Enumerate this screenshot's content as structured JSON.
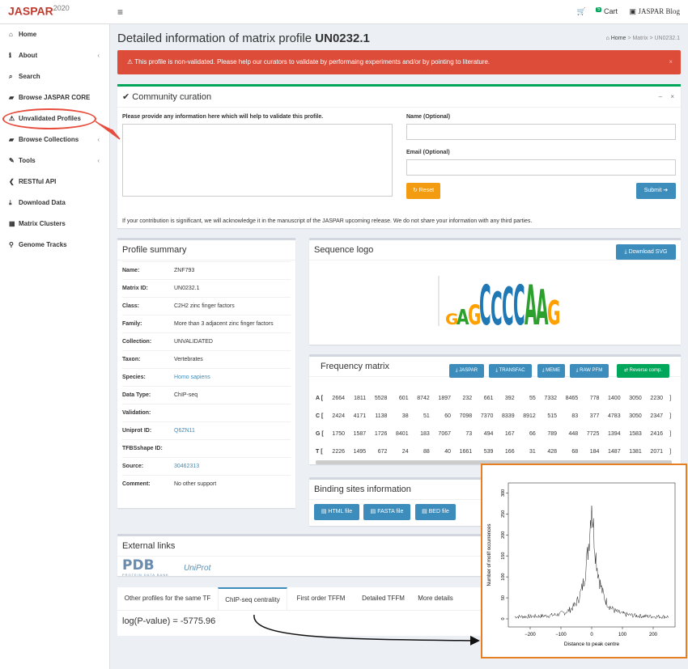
{
  "topbar": {
    "logo_text": "JASPAR",
    "logo_year": "2020",
    "cart_label": "Cart",
    "cart_count": "5",
    "blog_label": "JASPAR Blog"
  },
  "sidebar": {
    "items": [
      {
        "label": "Home",
        "icon": "home-icon",
        "glyph": "⌂",
        "chevron": ""
      },
      {
        "label": "About",
        "icon": "info-icon",
        "glyph": "ℹ",
        "chevron": "‹"
      },
      {
        "label": "Search",
        "icon": "search-icon",
        "glyph": "⌕",
        "chevron": ""
      },
      {
        "label": "Browse JASPAR CORE",
        "icon": "folder-icon",
        "glyph": "▰",
        "chevron": ""
      },
      {
        "label": "Unvalidated Profiles",
        "icon": "warning-icon",
        "glyph": "⚠",
        "chevron": ""
      },
      {
        "label": "Browse Collections",
        "icon": "folder-icon",
        "glyph": "▰",
        "chevron": "‹"
      },
      {
        "label": "Tools",
        "icon": "wrench-icon",
        "glyph": "✎",
        "chevron": "‹"
      },
      {
        "label": "RESTful API",
        "icon": "code-icon",
        "glyph": "❮",
        "chevron": ""
      },
      {
        "label": "Download Data",
        "icon": "download-icon",
        "glyph": "⤓",
        "chevron": ""
      },
      {
        "label": "Matrix Clusters",
        "icon": "clusters-icon",
        "glyph": "▦",
        "chevron": ""
      },
      {
        "label": "Genome Tracks",
        "icon": "map-marker-icon",
        "glyph": "⚲",
        "chevron": ""
      }
    ]
  },
  "page": {
    "title_prefix": "Detailed information of matrix profile ",
    "title_id": "UN0232.1",
    "breadcrumb_home": "Home",
    "breadcrumb_rest": "Matrix > UN0232.1"
  },
  "alert": {
    "text": "This profile is non-validated. Please help our curators to validate by performaing experiments and/or by pointing to literature.",
    "close": "×"
  },
  "curation": {
    "title": "Community curation",
    "prompt": "Please provide any information here which will help to validate this profile.",
    "name_label": "Name (Optional)",
    "email_label": "Email (Optional)",
    "reset_label": "Reset",
    "submit_label": "Submit",
    "note": "If your contribution is significant, we will acknowledge it in the manuscript of the JASPAR upcoming release. We do not share your information with any third parties.",
    "tool_minus": "–",
    "tool_close": "×"
  },
  "summary": {
    "title": "Profile summary",
    "rows": [
      {
        "key": "Name:",
        "value": "ZNF793",
        "link": false
      },
      {
        "key": "Matrix ID:",
        "value": "UN0232.1",
        "link": false
      },
      {
        "key": "Class:",
        "value": "C2H2 zinc finger factors",
        "link": false
      },
      {
        "key": "Family:",
        "value": "More than 3 adjacent zinc finger factors",
        "link": false
      },
      {
        "key": "Collection:",
        "value": "UNVALIDATED",
        "link": false
      },
      {
        "key": "Taxon:",
        "value": "Vertebrates",
        "link": false
      },
      {
        "key": "Species:",
        "value": "Homo sapiens",
        "link": true
      },
      {
        "key": "Data Type:",
        "value": "ChIP-seq",
        "link": false
      },
      {
        "key": "Validation:",
        "value": "",
        "link": false
      },
      {
        "key": "Uniprot ID:",
        "value": "Q6ZN11",
        "link": true
      },
      {
        "key": "TFBSshape ID:",
        "value": "",
        "link": false
      },
      {
        "key": "Source:",
        "value": "30462313",
        "link": true
      },
      {
        "key": "Comment:",
        "value": "No other support",
        "link": false
      }
    ]
  },
  "logo": {
    "title": "Sequence logo",
    "download_label": "Download SVG",
    "letters": "GAGCCCCAAG"
  },
  "freq": {
    "title": "Frequency matrix",
    "buttons": [
      "JASPAR",
      "TRANSFAC",
      "MEME",
      "RAW PFM",
      "Reverse comp."
    ],
    "rows": [
      {
        "base": "A [",
        "values": [
          "2664",
          "1811",
          "5528",
          "601",
          "8742",
          "1897",
          "232",
          "661",
          "392",
          "55",
          "7332",
          "8465",
          "778",
          "1400",
          "3050",
          "2230"
        ],
        "end": "]"
      },
      {
        "base": "C [",
        "values": [
          "2424",
          "4171",
          "1138",
          "38",
          "51",
          "60",
          "7098",
          "7370",
          "8339",
          "8912",
          "515",
          "83",
          "377",
          "4783",
          "3050",
          "2347"
        ],
        "end": "]"
      },
      {
        "base": "G [",
        "values": [
          "1750",
          "1587",
          "1726",
          "8401",
          "183",
          "7067",
          "73",
          "494",
          "167",
          "66",
          "789",
          "448",
          "7725",
          "1394",
          "1583",
          "2416"
        ],
        "end": "]"
      },
      {
        "base": "T [",
        "values": [
          "2226",
          "1495",
          "672",
          "24",
          "88",
          "40",
          "1661",
          "539",
          "166",
          "31",
          "428",
          "68",
          "184",
          "1487",
          "1381",
          "2071"
        ],
        "end": "]"
      }
    ]
  },
  "binding": {
    "title": "Binding sites information",
    "buttons": [
      "HTML file",
      "FASTA file",
      "BED file"
    ]
  },
  "external": {
    "title": "External links",
    "pdb_label": "PDB",
    "pdb_sub": "PROTEIN DATA BANK",
    "uniprot_label": "UniProt"
  },
  "tabs": {
    "items": [
      "Other profiles for the same TF",
      "ChIP-seq centrality",
      "First order TFFM",
      "Detailed TFFM",
      "More details"
    ],
    "active": 1,
    "pvalue": "log(P-value) = -5775.96"
  },
  "centrality_plot": {
    "xlabel": "Distance to peak centre",
    "ylabel": "Number of motif occurrences",
    "xticks": [
      "−200",
      "−100",
      "0",
      "100",
      "200"
    ],
    "yticks": [
      "0",
      "50",
      "100",
      "150",
      "200",
      "250",
      "300"
    ]
  },
  "colors": {
    "accent": "#3c8dbc",
    "danger": "#dd4b39",
    "success": "#00a65a",
    "warning": "#f39c12",
    "annotation": "#e67e22"
  }
}
